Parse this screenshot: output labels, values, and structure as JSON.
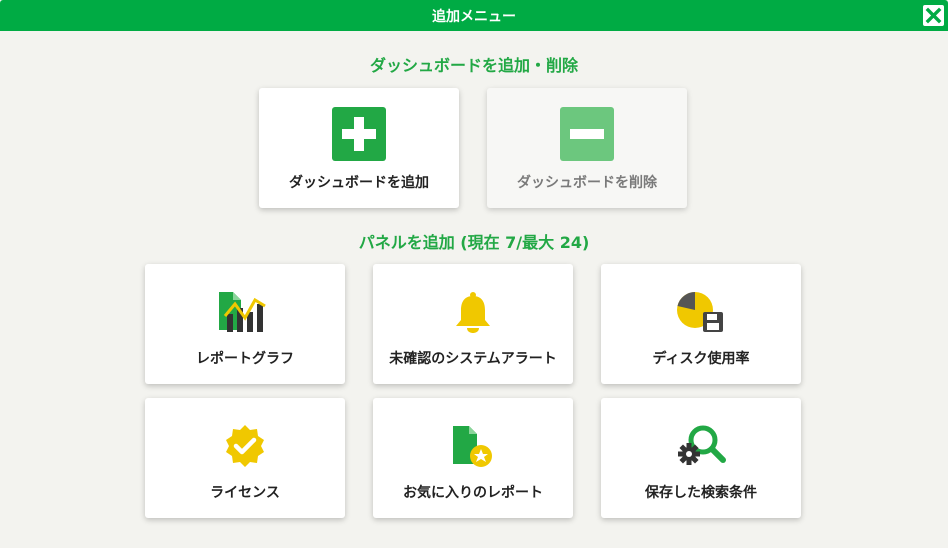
{
  "header": {
    "title": "追加メニュー",
    "close_icon": "close-icon"
  },
  "dashboard_section": {
    "title": "ダッシュボードを追加・削除",
    "add": {
      "label": "ダッシュボードを追加",
      "icon": "plus-icon"
    },
    "remove": {
      "label": "ダッシュボードを削除",
      "icon": "minus-icon",
      "state": "disabled"
    }
  },
  "panel_section": {
    "title": "パネルを追加 (現在 7/最大 24)",
    "items": [
      {
        "label": "レポートグラフ",
        "icon": "report-graph-icon"
      },
      {
        "label": "未確認のシステムアラート",
        "icon": "bell-icon"
      },
      {
        "label": "ディスク使用率",
        "icon": "disk-usage-icon"
      },
      {
        "label": "ライセンス",
        "icon": "license-badge-icon"
      },
      {
        "label": "お気に入りのレポート",
        "icon": "favorite-report-icon"
      },
      {
        "label": "保存した検索条件",
        "icon": "saved-search-icon"
      }
    ]
  },
  "colors": {
    "primary": "#00ab44",
    "accent_yellow": "#f0c800",
    "title_green": "#22a845"
  }
}
